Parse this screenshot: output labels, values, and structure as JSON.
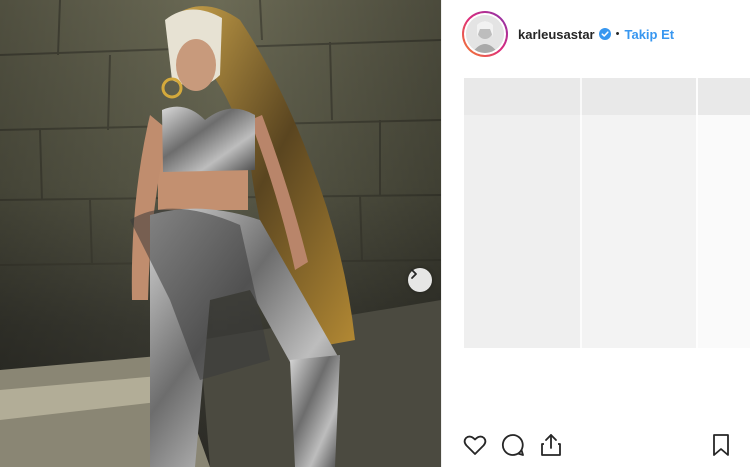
{
  "post": {
    "username": "karleusastar",
    "separator": "•",
    "follow_label": "Takip Et",
    "verified": true
  },
  "colors": {
    "accent": "#3897f0",
    "text": "#262626",
    "placeholder_light": "#f3f3f3",
    "placeholder_dark": "#e9e9e9"
  },
  "icons": {
    "like": "heart-icon",
    "comment": "comment-icon",
    "share": "share-icon",
    "save": "bookmark-icon",
    "next": "chevron-right-icon",
    "verified": "verified-badge-icon"
  }
}
